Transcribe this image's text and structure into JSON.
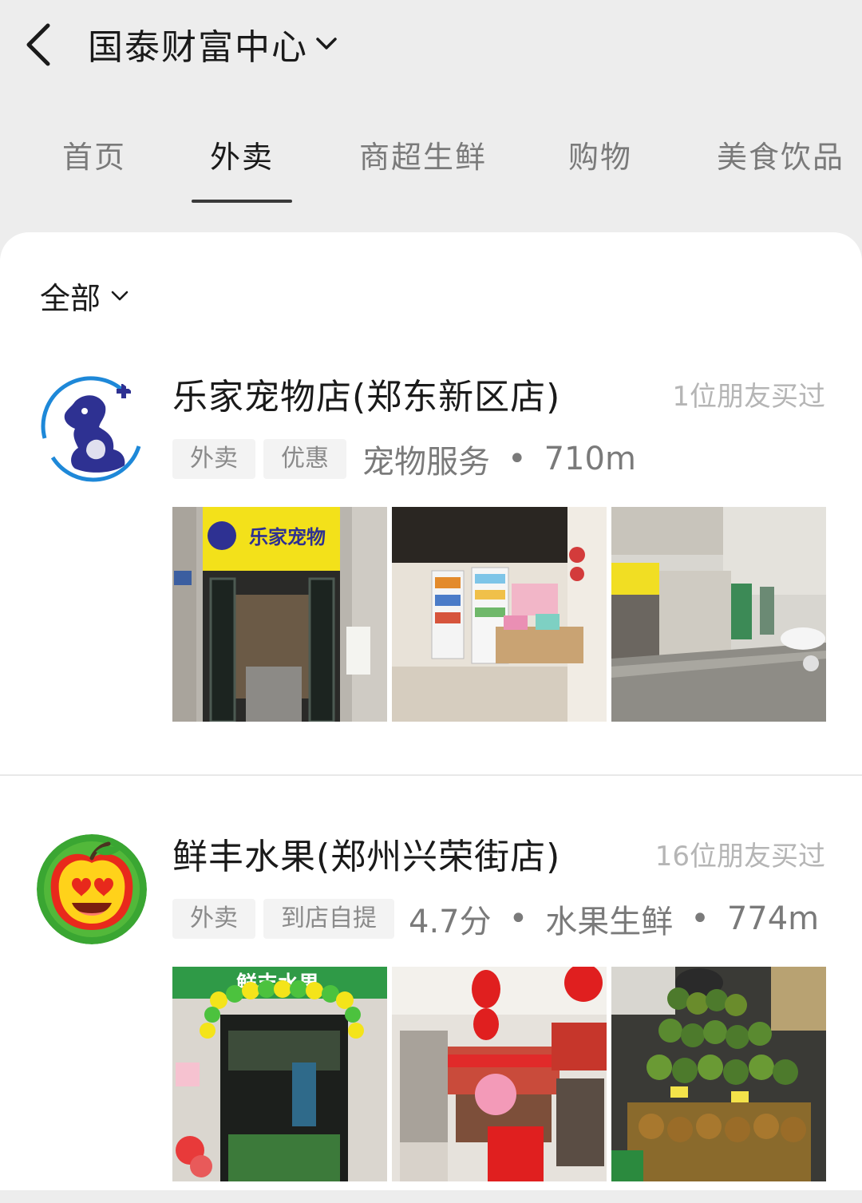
{
  "header": {
    "location": "国泰财富中心",
    "back_icon": "chevron-left-icon",
    "dropdown_icon": "chevron-down-icon"
  },
  "tabs": [
    {
      "label": "首页",
      "active": false
    },
    {
      "label": "外卖",
      "active": true
    },
    {
      "label": "商超生鲜",
      "active": false
    },
    {
      "label": "购物",
      "active": false
    },
    {
      "label": "美食饮品",
      "active": false
    }
  ],
  "filter": {
    "label": "全部",
    "icon": "chevron-down-icon"
  },
  "stores": [
    {
      "name": "乐家宠物店(郑东新区店)",
      "friends": "1位朋友买过",
      "tags": [
        "外卖",
        "优惠"
      ],
      "rating": "",
      "category": "宠物服务",
      "distance": "710m",
      "logo": "pet-dog-cat-logo",
      "photo_signage": "乐家宠物",
      "photos": [
        "storefront-photo",
        "interior-shelves-photo",
        "street-view-photo"
      ]
    },
    {
      "name": "鲜丰水果(郑州兴荣街店)",
      "friends": "16位朋友买过",
      "tags": [
        "外卖",
        "到店自提"
      ],
      "rating": "4.7分",
      "category": "水果生鲜",
      "distance": "774m",
      "logo": "apple-heart-eyes-logo",
      "photo_signage": "鲜丰水果",
      "photos": [
        "balloon-storefront-photo",
        "lanterns-interior-photo",
        "fruit-display-photo"
      ]
    }
  ],
  "colors": {
    "page_bg": "#ededed",
    "card_bg": "#ffffff",
    "text_primary": "#1a1a1a",
    "text_secondary": "#7a7a7a",
    "text_muted": "#b5b5b5",
    "tag_bg": "#f3f3f3",
    "pet_logo_blue": "#2e3192",
    "fruit_logo_green": "#3aa632"
  }
}
